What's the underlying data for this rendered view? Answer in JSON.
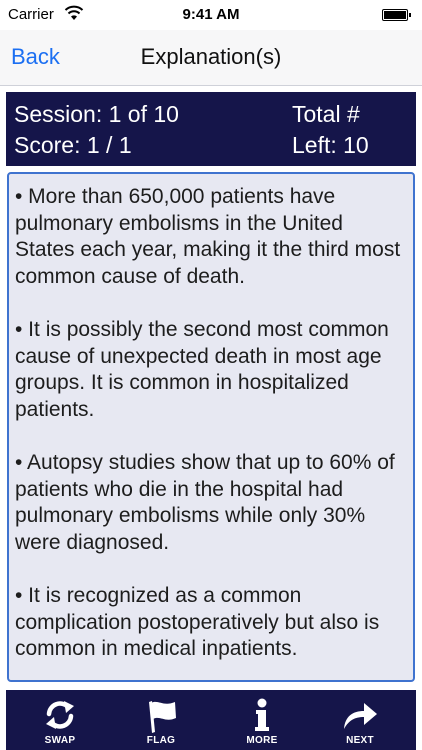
{
  "status_bar": {
    "carrier": "Carrier",
    "time": "9:41 AM"
  },
  "nav": {
    "back_label": "Back",
    "title": "Explanation(s)"
  },
  "session": {
    "session_text": "Session: 1 of 10",
    "score_text": "Score: 1 / 1",
    "total_text": "Total #",
    "left_text": "Left: 10"
  },
  "explanation": {
    "paragraphs": [
      "• More than 650,000 patients have pulmonary embolisms  in the United States each year, making it the third most common cause of death.",
      "•  It is possibly the second most common cause of unexpected death in most age groups. It is common in hospitalized patients.",
      "•  Autopsy studies show that up to 60% of patients who die in the hospital had pulmonary embolisms while only 30% were diagnosed.",
      "•  It is recognized as a common complication postoperatively but also is common in medical inpatients."
    ]
  },
  "toolbar": {
    "swap_label": "SWAP",
    "flag_label": "FLAG",
    "more_label": "MORE",
    "next_label": "NEXT"
  },
  "colors": {
    "panel_navy": "#15154a",
    "link_blue": "#1b6ff2",
    "box_border": "#3f73cf",
    "box_fill": "#e7e8f2"
  }
}
